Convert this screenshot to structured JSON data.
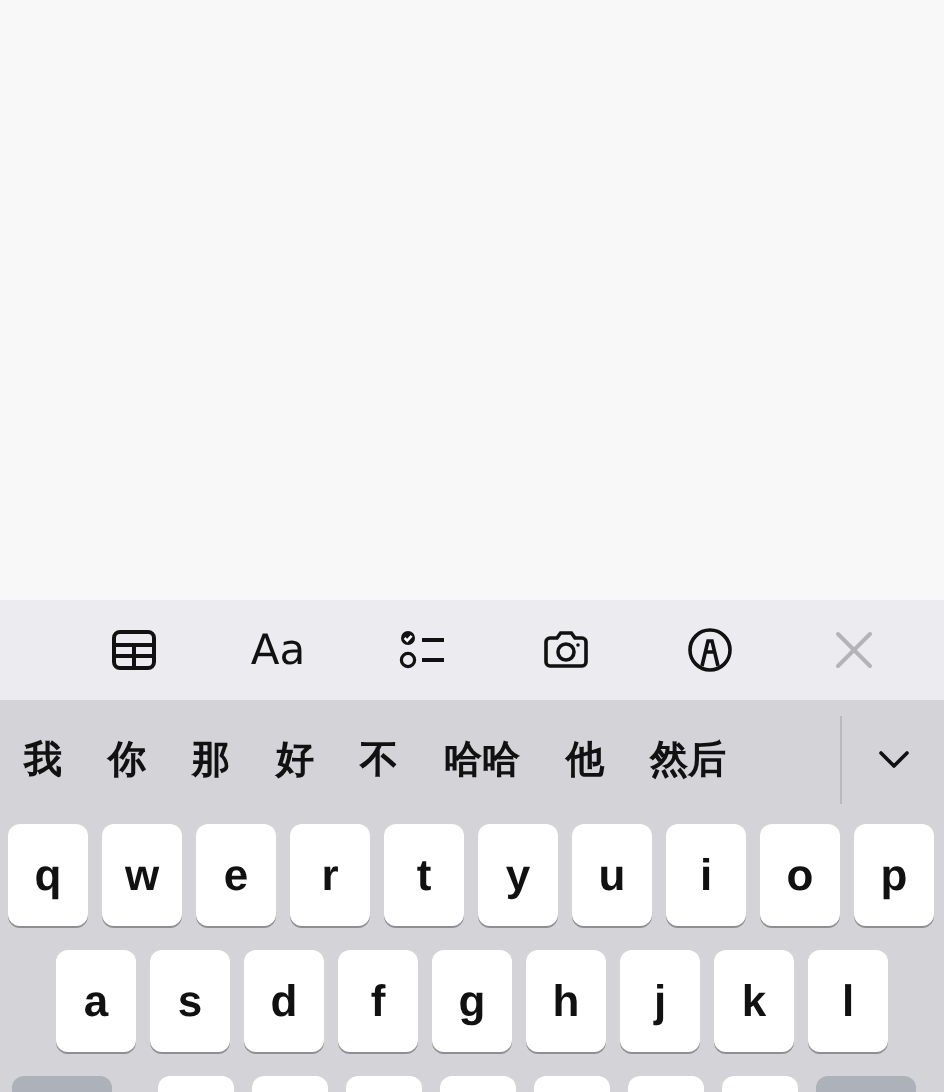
{
  "toolbar": {
    "items": [
      {
        "kind": "table"
      },
      {
        "kind": "text",
        "label": "Aa"
      },
      {
        "kind": "checklist"
      },
      {
        "kind": "camera"
      },
      {
        "kind": "markup"
      },
      {
        "kind": "close"
      }
    ]
  },
  "candidates": {
    "words": [
      "我",
      "你",
      "那",
      "好",
      "不",
      "哈哈",
      "他",
      "然后"
    ]
  },
  "keyboard": {
    "rows": [
      [
        "q",
        "w",
        "e",
        "r",
        "t",
        "y",
        "u",
        "i",
        "o",
        "p"
      ],
      [
        "a",
        "s",
        "d",
        "f",
        "g",
        "h",
        "j",
        "k",
        "l"
      ]
    ]
  }
}
